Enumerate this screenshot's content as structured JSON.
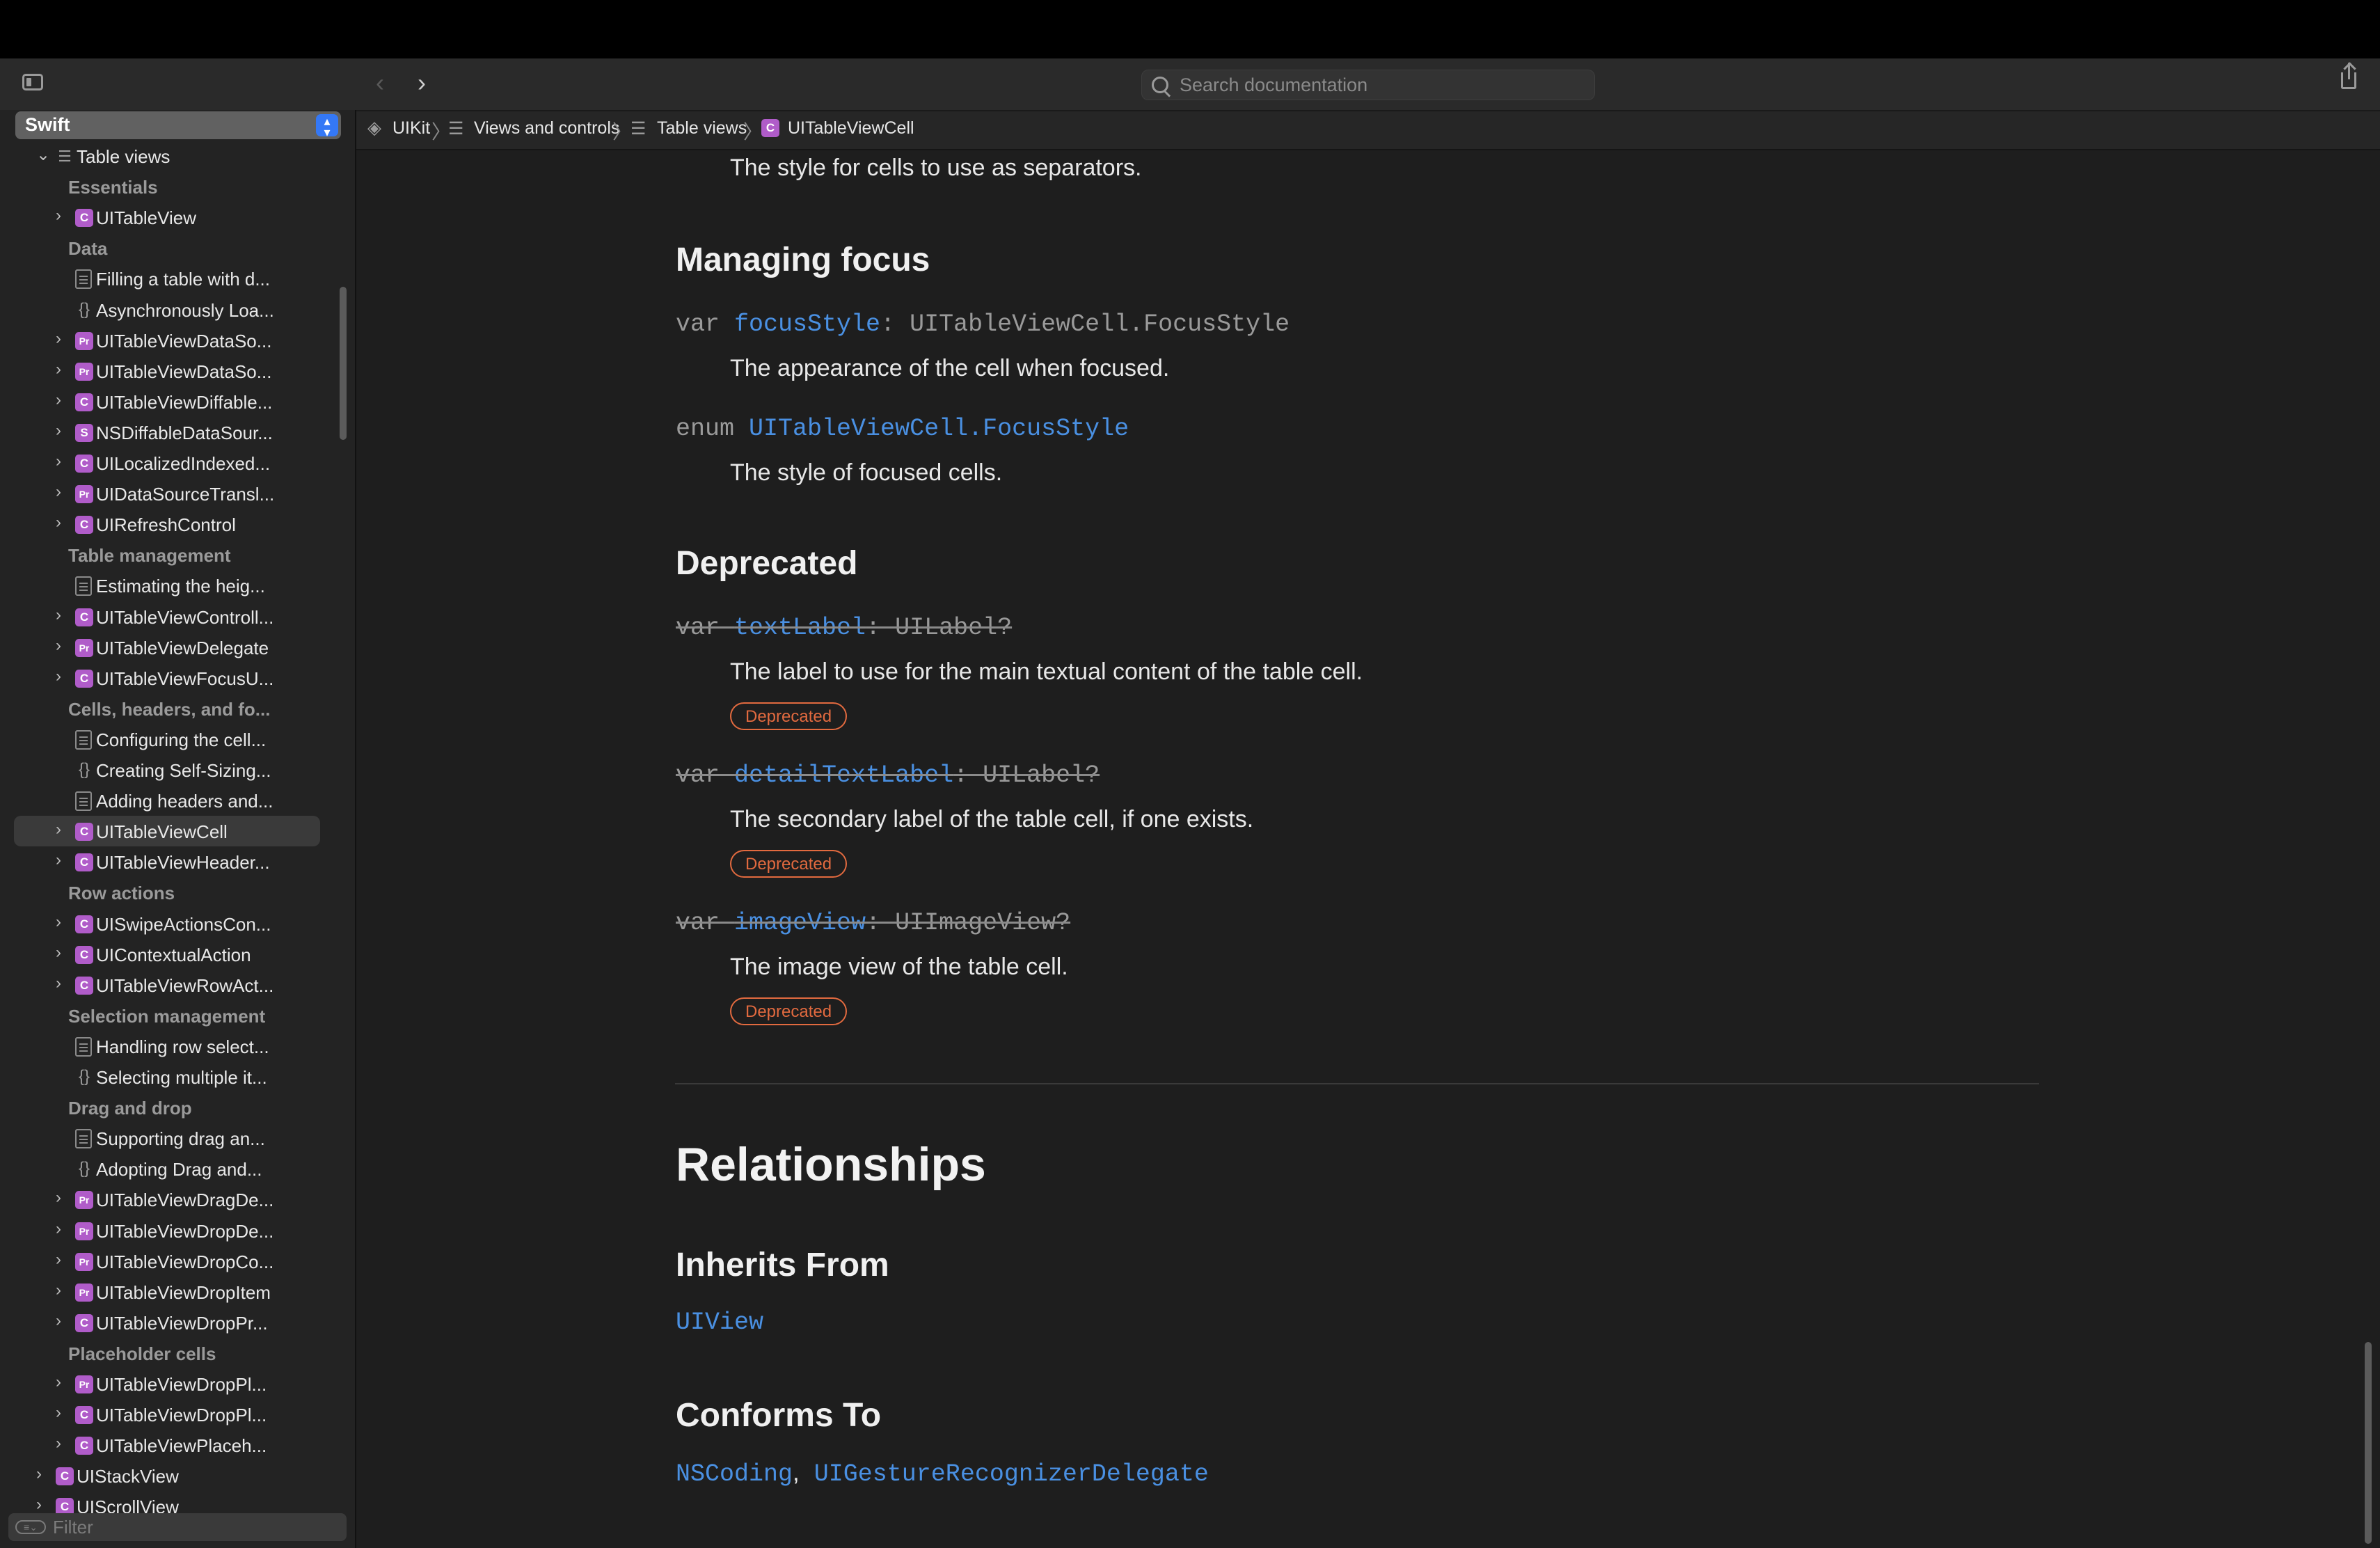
{
  "toolbar": {
    "search_placeholder": "Search documentation"
  },
  "sidebar": {
    "language": "Swift",
    "filter_placeholder": "Filter",
    "items": [
      {
        "label": "Table views",
        "icon": "list",
        "level": 1,
        "disclosure": "expanded",
        "kind": "topic"
      },
      {
        "label": "Essentials",
        "level": 2,
        "kind": "group"
      },
      {
        "label": "UITableView",
        "icon": "C",
        "level": 2,
        "disclosure": "collapsed",
        "kind": "class"
      },
      {
        "label": "Data",
        "level": 2,
        "kind": "group"
      },
      {
        "label": "Filling a table with d...",
        "icon": "doc",
        "level": 2,
        "kind": "article"
      },
      {
        "label": "Asynchronously Loa...",
        "icon": "braces",
        "level": 2,
        "kind": "sample"
      },
      {
        "label": "UITableViewDataSo...",
        "icon": "Pr",
        "level": 2,
        "disclosure": "collapsed",
        "kind": "protocol"
      },
      {
        "label": "UITableViewDataSo...",
        "icon": "Pr",
        "level": 2,
        "disclosure": "collapsed",
        "kind": "protocol"
      },
      {
        "label": "UITableViewDiffable...",
        "icon": "C",
        "level": 2,
        "disclosure": "collapsed",
        "kind": "class"
      },
      {
        "label": "NSDiffableDataSour...",
        "icon": "S",
        "level": 2,
        "disclosure": "collapsed",
        "kind": "struct"
      },
      {
        "label": "UILocalizedIndexed...",
        "icon": "C",
        "level": 2,
        "disclosure": "collapsed",
        "kind": "class"
      },
      {
        "label": "UIDataSourceTransl...",
        "icon": "Pr",
        "level": 2,
        "disclosure": "collapsed",
        "kind": "protocol"
      },
      {
        "label": "UIRefreshControl",
        "icon": "C",
        "level": 2,
        "disclosure": "collapsed",
        "kind": "class"
      },
      {
        "label": "Table management",
        "level": 2,
        "kind": "group"
      },
      {
        "label": "Estimating the heig...",
        "icon": "doc",
        "level": 2,
        "kind": "article"
      },
      {
        "label": "UITableViewControll...",
        "icon": "C",
        "level": 2,
        "disclosure": "collapsed",
        "kind": "class"
      },
      {
        "label": "UITableViewDelegate",
        "icon": "Pr",
        "level": 2,
        "disclosure": "collapsed",
        "kind": "protocol"
      },
      {
        "label": "UITableViewFocusU...",
        "icon": "C",
        "level": 2,
        "disclosure": "collapsed",
        "kind": "class"
      },
      {
        "label": "Cells, headers, and fo...",
        "level": 2,
        "kind": "group"
      },
      {
        "label": "Configuring the cell...",
        "icon": "doc",
        "level": 2,
        "kind": "article"
      },
      {
        "label": "Creating Self-Sizing...",
        "icon": "braces",
        "level": 2,
        "kind": "sample"
      },
      {
        "label": "Adding headers and...",
        "icon": "doc",
        "level": 2,
        "kind": "article"
      },
      {
        "label": "UITableViewCell",
        "icon": "C",
        "level": 2,
        "disclosure": "collapsed",
        "kind": "class",
        "selected": true
      },
      {
        "label": "UITableViewHeader...",
        "icon": "C",
        "level": 2,
        "disclosure": "collapsed",
        "kind": "class"
      },
      {
        "label": "Row actions",
        "level": 2,
        "kind": "group"
      },
      {
        "label": "UISwipeActionsCon...",
        "icon": "C",
        "level": 2,
        "disclosure": "collapsed",
        "kind": "class"
      },
      {
        "label": "UIContextualAction",
        "icon": "C",
        "level": 2,
        "disclosure": "collapsed",
        "kind": "class"
      },
      {
        "label": "UITableViewRowAct...",
        "icon": "C",
        "level": 2,
        "disclosure": "collapsed",
        "kind": "class"
      },
      {
        "label": "Selection management",
        "level": 2,
        "kind": "group"
      },
      {
        "label": "Handling row select...",
        "icon": "doc",
        "level": 2,
        "kind": "article"
      },
      {
        "label": "Selecting multiple it...",
        "icon": "braces",
        "level": 2,
        "kind": "sample"
      },
      {
        "label": "Drag and drop",
        "level": 2,
        "kind": "group"
      },
      {
        "label": "Supporting drag an...",
        "icon": "doc",
        "level": 2,
        "kind": "article"
      },
      {
        "label": "Adopting Drag and...",
        "icon": "braces",
        "level": 2,
        "kind": "sample"
      },
      {
        "label": "UITableViewDragDe...",
        "icon": "Pr",
        "level": 2,
        "disclosure": "collapsed",
        "kind": "protocol"
      },
      {
        "label": "UITableViewDropDe...",
        "icon": "Pr",
        "level": 2,
        "disclosure": "collapsed",
        "kind": "protocol"
      },
      {
        "label": "UITableViewDropCo...",
        "icon": "Pr",
        "level": 2,
        "disclosure": "collapsed",
        "kind": "protocol"
      },
      {
        "label": "UITableViewDropItem",
        "icon": "Pr",
        "level": 2,
        "disclosure": "collapsed",
        "kind": "protocol"
      },
      {
        "label": "UITableViewDropPr...",
        "icon": "C",
        "level": 2,
        "disclosure": "collapsed",
        "kind": "class"
      },
      {
        "label": "Placeholder cells",
        "level": 2,
        "kind": "group"
      },
      {
        "label": "UITableViewDropPl...",
        "icon": "Pr",
        "level": 2,
        "disclosure": "collapsed",
        "kind": "protocol"
      },
      {
        "label": "UITableViewDropPl...",
        "icon": "C",
        "level": 2,
        "disclosure": "collapsed",
        "kind": "class"
      },
      {
        "label": "UITableViewPlaceh...",
        "icon": "C",
        "level": 2,
        "disclosure": "collapsed",
        "kind": "class"
      },
      {
        "label": "UIStackView",
        "icon": "C",
        "level": 1,
        "disclosure": "collapsed",
        "kind": "class"
      },
      {
        "label": "UIScrollView",
        "icon": "C",
        "level": 1,
        "disclosure": "collapsed",
        "kind": "class"
      }
    ]
  },
  "breadcrumb": {
    "items": [
      {
        "label": "UIKit",
        "icon": "framework-icon"
      },
      {
        "label": "Views and controls",
        "icon": "list-icon"
      },
      {
        "label": "Table views",
        "icon": "list-icon"
      },
      {
        "label": "UITableViewCell",
        "icon": "C"
      }
    ]
  },
  "content": {
    "top_desc": "The style for cells to use as separators.",
    "focus": {
      "heading": "Managing focus",
      "var_keyword": "var",
      "var_name": "focusStyle",
      "var_type": ": UITableViewCell.FocusStyle",
      "var_desc": "The appearance of the cell when focused.",
      "enum_keyword": "enum",
      "enum_name": "UITableViewCell.FocusStyle",
      "enum_desc": "The style of focused cells."
    },
    "deprecated": {
      "heading": "Deprecated",
      "badge": "Deprecated",
      "items": [
        {
          "keyword": "var",
          "name": "textLabel",
          "type": ": UILabel?",
          "desc": "The label to use for the main textual content of the table cell."
        },
        {
          "keyword": "var",
          "name": "detailTextLabel",
          "type": ": UILabel?",
          "desc": "The secondary label of the table cell, if one exists."
        },
        {
          "keyword": "var",
          "name": "imageView",
          "type": ": UIImageView?",
          "desc": "The image view of the table cell."
        }
      ]
    },
    "relationships": {
      "heading": "Relationships",
      "inherits_heading": "Inherits From",
      "inherits": "UIView",
      "conforms_heading": "Conforms To",
      "conforms_1": "NSCoding",
      "conforms_sep": ",",
      "conforms_2": "UIGestureRecognizerDelegate"
    }
  },
  "colors": {
    "background": "#1e1e1e",
    "sidebar": "#232323",
    "link": "#4a90e2",
    "deprecated": "#e26a3f",
    "symbol_icon": "#b05cc9",
    "accent": "#3478f6"
  }
}
